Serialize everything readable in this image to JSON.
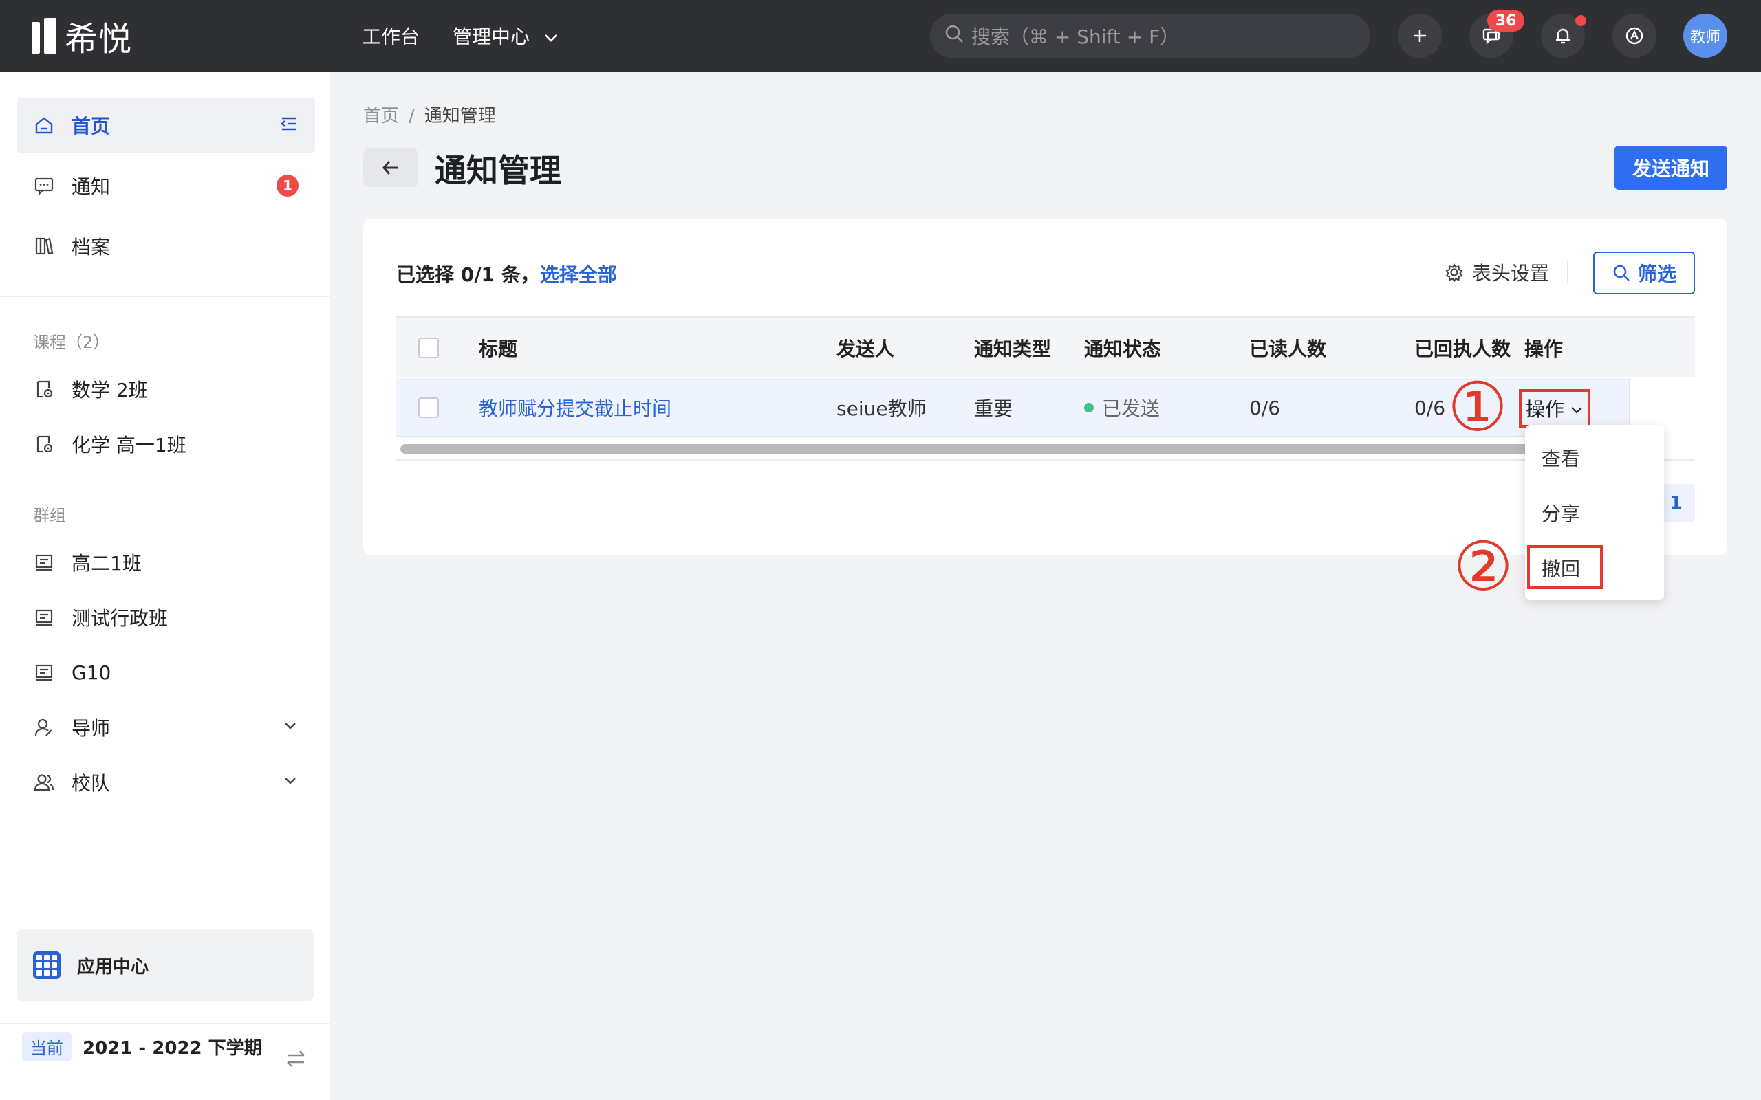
{
  "topbar": {
    "logo_text": "希悦",
    "nav": [
      {
        "label": "工作台"
      },
      {
        "label": "管理中心"
      }
    ],
    "search_placeholder": "搜索（⌘ + Shift + F）",
    "message_badge": "36",
    "avatar_text": "教师"
  },
  "sidebar": {
    "home": "首页",
    "notify": "通知",
    "notify_badge": "1",
    "archive": "档案",
    "course_section": "课程（2）",
    "courses": [
      "数学 2班",
      "化学 高一1班"
    ],
    "group_section": "群组",
    "groups": [
      "高二1班",
      "测试行政班",
      "G10"
    ],
    "mentor": "导师",
    "team": "校队",
    "app_center": "应用中心",
    "term_tag": "当前",
    "term": "2021 - 2022 下学期"
  },
  "main": {
    "breadcrumb": [
      "首页",
      "通知管理"
    ],
    "breadcrumb_sep": "/",
    "title": "通知管理",
    "send_button": "发送通知",
    "selection_text": "已选择 0/1 条，",
    "select_all": "选择全部",
    "column_settings": "表头设置",
    "filter": "筛选",
    "table": {
      "headers": [
        "标题",
        "发送人",
        "通知类型",
        "通知状态",
        "已读人数",
        "已回执人数",
        "操作"
      ],
      "rows": [
        {
          "title": "教师赋分提交截止时间",
          "sender": "seiue教师",
          "type": "重要",
          "status": "已发送",
          "read": "0/6",
          "receipt": "0/6",
          "action": "操作"
        }
      ]
    },
    "page_number": "1",
    "dropdown": [
      "查看",
      "分享",
      "撤回"
    ],
    "annotations": [
      "①",
      "②"
    ]
  },
  "colors": {
    "accent": "#2a63d8",
    "topbar": "#2f3034",
    "annotation": "#e23a2a",
    "status_sent": "#3cc38f"
  }
}
